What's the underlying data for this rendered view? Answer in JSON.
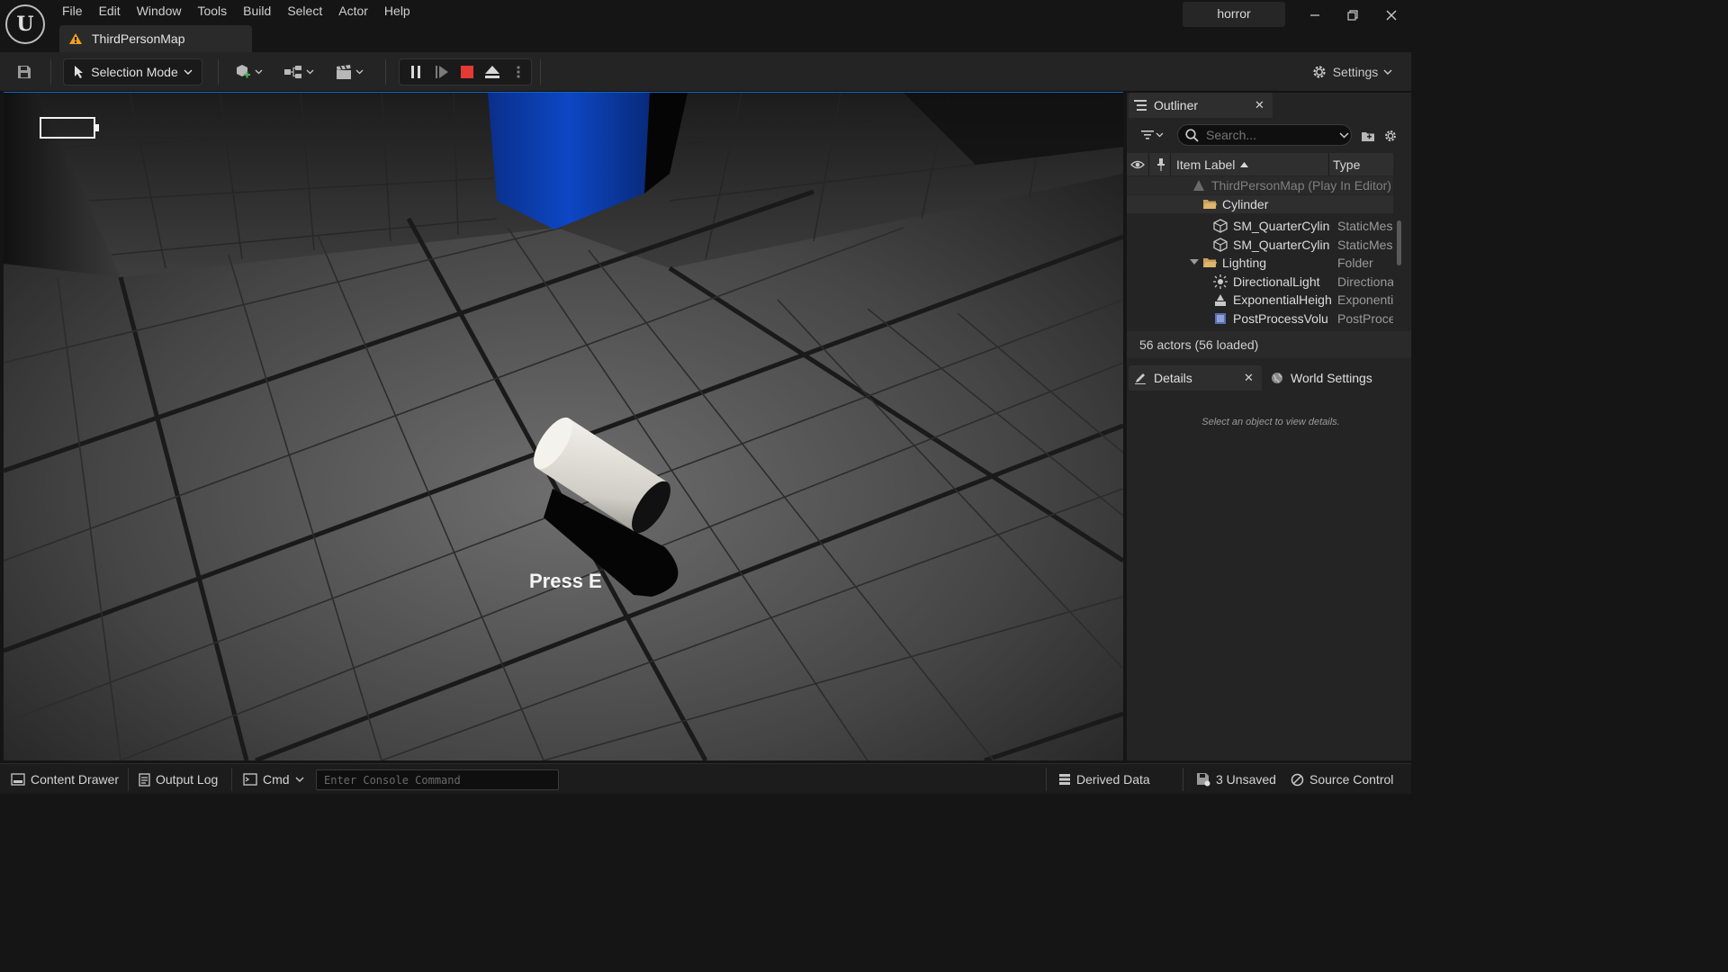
{
  "menu": [
    "File",
    "Edit",
    "Window",
    "Tools",
    "Build",
    "Select",
    "Actor",
    "Help"
  ],
  "document_tab": "ThirdPersonMap",
  "project_name": "horror",
  "toolbar": {
    "selection_mode_label": "Selection Mode",
    "settings_label": "Settings"
  },
  "viewport": {
    "prompt_text": "Press E"
  },
  "outliner": {
    "title": "Outliner",
    "search_placeholder": "Search...",
    "col_label": "Item Label",
    "col_type": "Type",
    "rows": [
      {
        "label": "ThirdPersonMap (Play In Editor)",
        "type": "",
        "kind": "map"
      },
      {
        "label": "Cylinder",
        "type": "",
        "kind": "folder"
      },
      {
        "label": "SM_QuarterCylin",
        "type": "StaticMes",
        "kind": "mesh"
      },
      {
        "label": "SM_QuarterCylin",
        "type": "StaticMes",
        "kind": "mesh"
      },
      {
        "label": "Lighting",
        "type": "Folder",
        "kind": "folder"
      },
      {
        "label": "DirectionalLight",
        "type": "Directiona",
        "kind": "light"
      },
      {
        "label": "ExponentialHeigh",
        "type": "Exponenti",
        "kind": "fog"
      },
      {
        "label": "PostProcessVolu",
        "type": "PostProce",
        "kind": "volume"
      }
    ],
    "actor_count": "56 actors (56 loaded)"
  },
  "details": {
    "title": "Details",
    "world_settings": "World Settings",
    "hint": "Select an object to view details."
  },
  "statusbar": {
    "content_drawer": "Content Drawer",
    "output_log": "Output Log",
    "cmd": "Cmd",
    "console_placeholder": "Enter Console Command",
    "derived_data": "Derived Data",
    "unsaved": "3 Unsaved",
    "source_control": "Source Control"
  },
  "colors": {
    "accent_blue": "#1565c0",
    "stop_red": "#e53935",
    "folder": "#c9a05a",
    "warning": "#f0a020"
  }
}
